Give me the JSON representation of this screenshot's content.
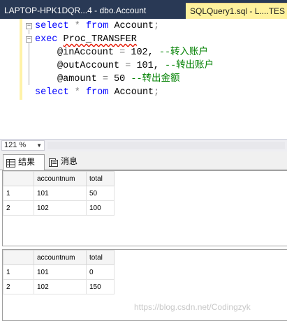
{
  "tabs": {
    "inactive": "LAPTOP-HPK1DQR...4 - dbo.Account",
    "active": "SQLQuery1.sql - L....TES"
  },
  "code": {
    "line1": {
      "kw": "select",
      "star": "*",
      "from": "from",
      "table": "Account",
      "end": ";"
    },
    "line2": {
      "kw": "exec",
      "proc": "Proc_TRANSFER"
    },
    "line3": {
      "param": "@inAccount",
      "eq": "=",
      "val": "102,",
      "comment": "--转入账户"
    },
    "line4": {
      "param": "@outAccount",
      "eq": "=",
      "val": "101,",
      "comment": "--转出账户"
    },
    "line5": {
      "param": "@amount",
      "eq": "=",
      "val": "50",
      "comment": "--转出金额"
    },
    "line6": {
      "kw": "select",
      "star": "*",
      "from": "from",
      "table": "Account",
      "end": ";"
    }
  },
  "zoom": {
    "value": "121 %"
  },
  "results_tabs": {
    "results": "结果",
    "messages": "消息"
  },
  "grid1": {
    "columns": [
      "accountnum",
      "total"
    ],
    "rows": [
      {
        "num": "1",
        "accountnum": "101",
        "total": "50"
      },
      {
        "num": "2",
        "accountnum": "102",
        "total": "100"
      }
    ]
  },
  "grid2": {
    "columns": [
      "accountnum",
      "total"
    ],
    "rows": [
      {
        "num": "1",
        "accountnum": "101",
        "total": "0"
      },
      {
        "num": "2",
        "accountnum": "102",
        "total": "150"
      }
    ]
  },
  "watermark": "https://blog.csdn.net/Codingzyk",
  "colors": {
    "tab_strip": "#293955",
    "active_tab": "#fff29d",
    "keyword": "#0000ff",
    "comment": "#008000",
    "operator": "#808080"
  }
}
